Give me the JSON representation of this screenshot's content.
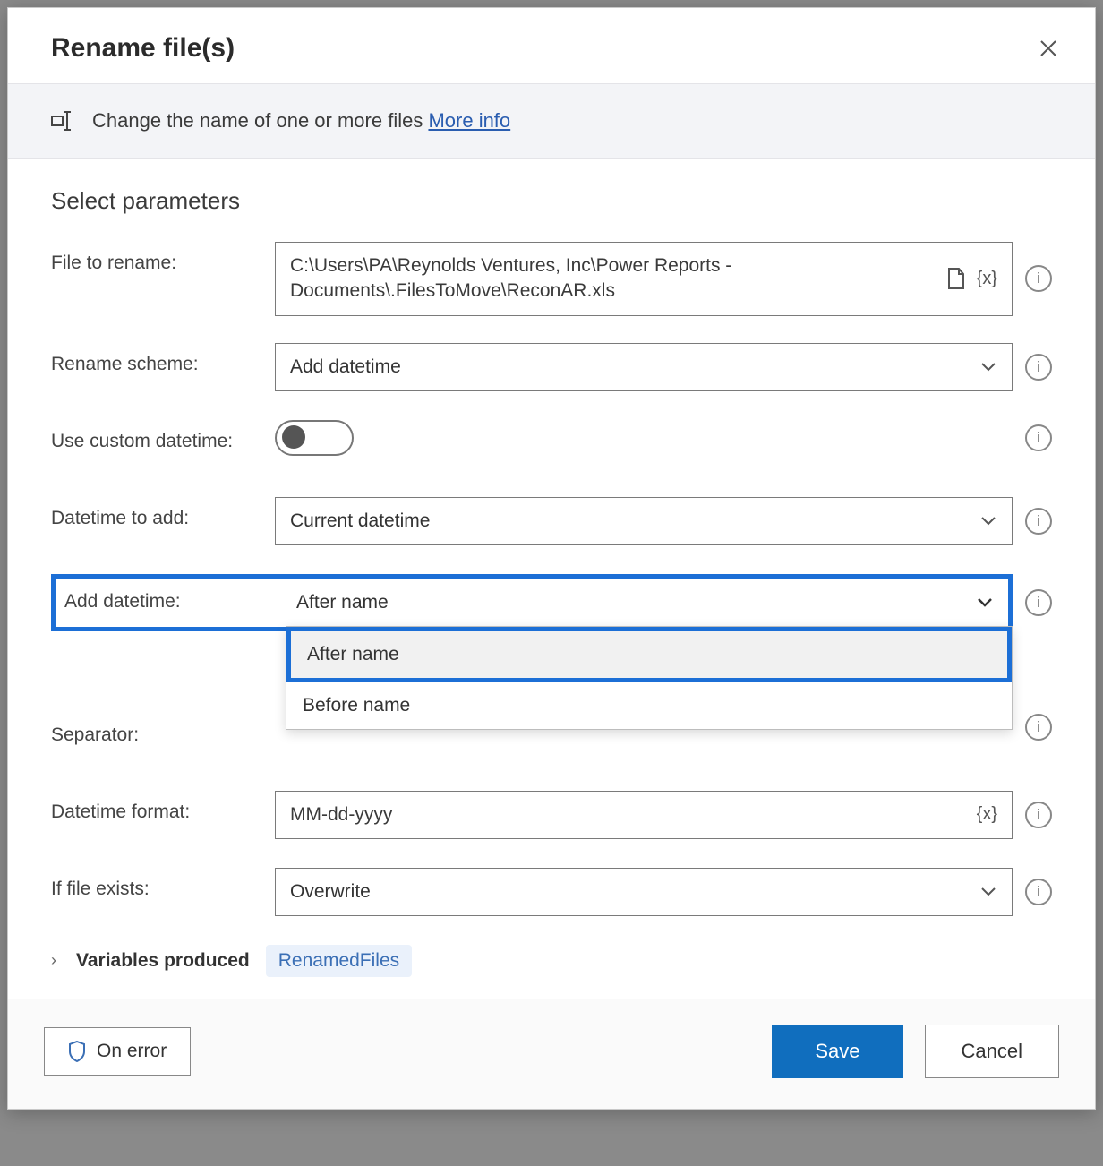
{
  "dialog": {
    "title": "Rename file(s)",
    "description": "Change the name of one or more files",
    "more_info": "More info"
  },
  "section_title": "Select parameters",
  "fields": {
    "file_to_rename": {
      "label": "File to rename:",
      "value": "C:\\Users\\PA\\Reynolds Ventures, Inc\\Power Reports - Documents\\.FilesToMove\\ReconAR.xls"
    },
    "rename_scheme": {
      "label": "Rename scheme:",
      "value": "Add datetime"
    },
    "use_custom_datetime": {
      "label": "Use custom datetime:",
      "value": false
    },
    "datetime_to_add": {
      "label": "Datetime to add:",
      "value": "Current datetime"
    },
    "add_datetime": {
      "label": "Add datetime:",
      "value": "After name",
      "options": [
        "After name",
        "Before name"
      ]
    },
    "separator": {
      "label": "Separator:",
      "value": ""
    },
    "datetime_format": {
      "label": "Datetime format:",
      "value": "MM-dd-yyyy"
    },
    "if_file_exists": {
      "label": "If file exists:",
      "value": "Overwrite"
    }
  },
  "variables_produced": {
    "label": "Variables produced",
    "chip": "RenamedFiles"
  },
  "footer": {
    "on_error": "On error",
    "save": "Save",
    "cancel": "Cancel"
  }
}
